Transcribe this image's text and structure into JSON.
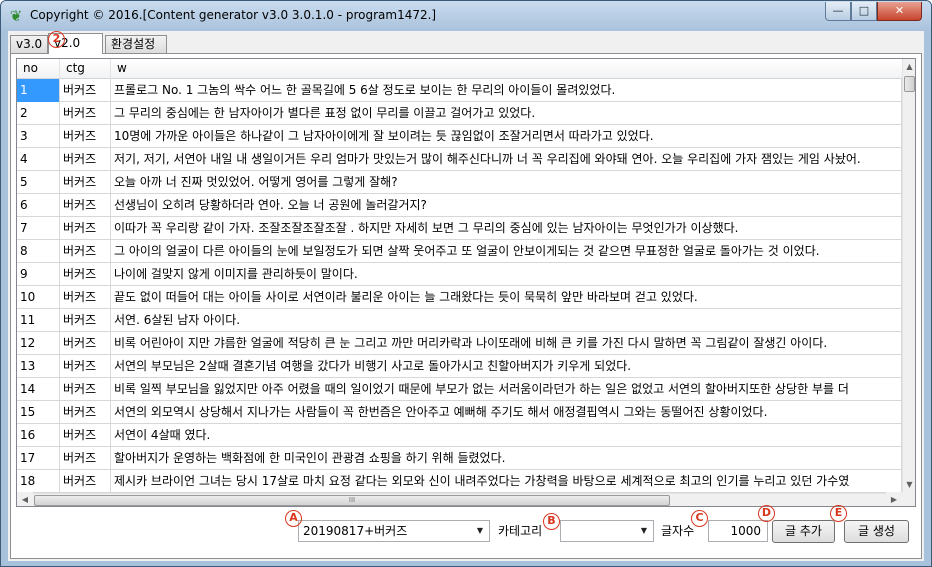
{
  "window": {
    "title": "Copyright © 2016.[Content generator v3.0 3.0.1.0 - program1472.]",
    "controls": {
      "minimize": "—",
      "maximize": "□",
      "close": "✕"
    }
  },
  "tabs": [
    {
      "label": "v3.0"
    },
    {
      "label": "v2.0"
    },
    {
      "label": "환경설정"
    }
  ],
  "markers": {
    "tab": "2",
    "a": "A",
    "b": "B",
    "c": "C",
    "d": "D",
    "e": "E"
  },
  "grid": {
    "columns": [
      "no",
      "ctg",
      "w"
    ],
    "rows": [
      {
        "no": "1",
        "ctg": "버커즈",
        "w": "프롤로그 No. 1 그놈의 싹수 어느 한 골목길에 5 6살 정도로 보이는 한 무리의 아이들이 몰려있었다."
      },
      {
        "no": "2",
        "ctg": "버커즈",
        "w": "그 무리의 중심에는 한 남자아이가 별다른 표정 없이 무리를 이끌고 걸어가고 있었다."
      },
      {
        "no": "3",
        "ctg": "버커즈",
        "w": "10명에 가까운 아이들은 하나같이 그 남자아이에게 잘 보이려는 듯 끊임없이 조잘거리면서 따라가고 있었다."
      },
      {
        "no": "4",
        "ctg": "버커즈",
        "w": "저기, 저기, 서연아 내일 내 생일이거든 우리 엄마가 맛있는거 많이 해주신다니까 너 꼭 우리집에 와야돼 연아. 오늘 우리집에 가자 잼있는 게임 사놨어."
      },
      {
        "no": "5",
        "ctg": "버커즈",
        "w": "오늘 아까 너 진짜 멋있었어. 어떻게 영어를 그렇게 잘해?"
      },
      {
        "no": "6",
        "ctg": "버커즈",
        "w": "선생님이 오히려 당황하더라 연아. 오늘 너 공원에 놀러갈거지?"
      },
      {
        "no": "7",
        "ctg": "버커즈",
        "w": "이따가 꼭 우리랑 같이 가자. 조잘조잘조잘조잘 . 하지만 자세히 보면 그 무리의 중심에 있는 남자아이는 무엇인가가 이상했다."
      },
      {
        "no": "8",
        "ctg": "버커즈",
        "w": "그 아이의 얼굴이 다른 아이들의 눈에 보일정도가 되면 살짝 웃어주고 또 얼굴이 안보이게되는 것 같으면 무표정한 얼굴로 돌아가는 것 이었다."
      },
      {
        "no": "9",
        "ctg": "버커즈",
        "w": "나이에 걸맞지 않게 이미지를 관리하듯이 말이다."
      },
      {
        "no": "10",
        "ctg": "버커즈",
        "w": "끝도 없이 떠들어 대는 아이들 사이로 서연이라 불리운 아이는 늘 그래왔다는 듯이 묵묵히 앞만 바라보며 걷고 있었다."
      },
      {
        "no": "11",
        "ctg": "버커즈",
        "w": "서연. 6살된 남자 아이다."
      },
      {
        "no": "12",
        "ctg": "버커즈",
        "w": "비록 어린아이 지만 갸름한 얼굴에 적당히 큰 눈 그리고 까만 머리카락과 나이또래에 비해 큰 키를 가진 다시 말하면 꼭 그림같이 잘생긴 아이다."
      },
      {
        "no": "13",
        "ctg": "버커즈",
        "w": "서연의 부모님은 2살때 결혼기념 여행을 갔다가 비행기 사고로 돌아가시고 친할아버지가 키우게 되었다."
      },
      {
        "no": "14",
        "ctg": "버커즈",
        "w": "비록 일찍 부모님을 잃었지만 아주 어렸을 때의 일이었기 때문에 부모가 없는 서러움이라던가 하는 일은 없었고 서연의 할아버지또한 상당한 부를 더"
      },
      {
        "no": "15",
        "ctg": "버커즈",
        "w": "서연의 외모역시 상당해서 지나가는 사람들이 꼭 한번즘은 안아주고 예뻐해 주기도 해서 애정결핍역시 그와는 동떨어진 상황이었다."
      },
      {
        "no": "16",
        "ctg": "버커즈",
        "w": "서연이 4살때 였다."
      },
      {
        "no": "17",
        "ctg": "버커즈",
        "w": "할아버지가 운영하는 백화점에 한 미국인이 관광겸 쇼핑을 하기 위해 들렸었다."
      },
      {
        "no": "18",
        "ctg": "버커즈",
        "w": "제시카 브라이언 그녀는 당시 17살로 마치 요정 같다는 외모와 신이 내려주었다는 가창력을 바탕으로 세계적으로 최고의 인기를 누리고 있던 가수였"
      }
    ],
    "hscroll_grip": "III"
  },
  "bottom": {
    "source_combo": "20190817+버커즈",
    "category_label": "카테고리",
    "category_combo": "",
    "count_label": "글자수",
    "count_value": "1000",
    "add_button": "글 추가",
    "generate_button": "글 생성"
  },
  "colors": {
    "selection": "#3399ff",
    "marker": "#d9361e"
  }
}
